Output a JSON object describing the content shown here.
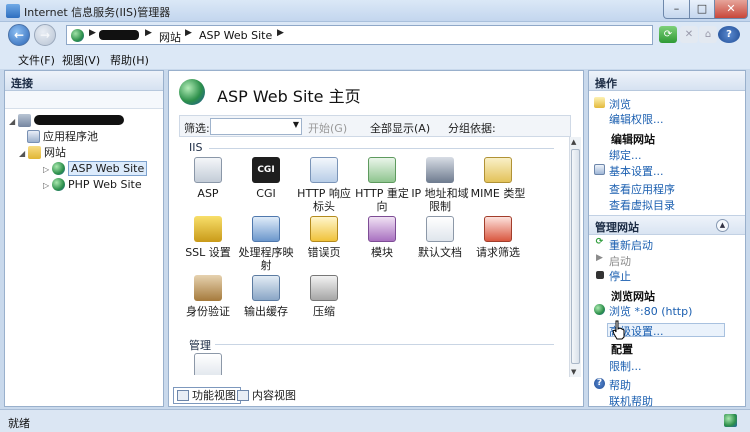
{
  "window": {
    "title": "Internet 信息服务(IIS)管理器"
  },
  "address": {
    "crumbs": [
      "网站",
      "ASP Web Site"
    ]
  },
  "menu": [
    "文件(F)",
    "视图(V)",
    "帮助(H)"
  ],
  "left_panel": {
    "header": "连接",
    "tree": {
      "app_pools": "应用程序池",
      "sites": "网站",
      "site1": "ASP Web Site",
      "site2": "PHP Web Site"
    }
  },
  "center": {
    "title": "ASP Web Site 主页",
    "filter": {
      "label": "筛选:",
      "start": "开始(G)",
      "show_all": "全部显示(A)",
      "group_by": "分组依据:"
    },
    "groups": {
      "iis": "IIS",
      "management": "管理"
    },
    "features": {
      "asp": "ASP",
      "cgi": "CGI",
      "cgi_glyph": "CGI",
      "http_headers": "HTTP 响应标头",
      "http_redirect": "HTTP 重定向",
      "ip_domain": "IP 地址和域限制",
      "mime": "MIME 类型",
      "ssl": "SSL 设置",
      "handler": "处理程序映射",
      "error_pages": "错误页",
      "modules": "模块",
      "default_doc": "默认文档",
      "request_filter": "请求筛选",
      "auth": "身份验证",
      "output_cache": "输出缓存",
      "compression": "压缩"
    },
    "view_tabs": {
      "features": "功能视图",
      "content": "内容视图"
    }
  },
  "right_panel": {
    "header": "操作",
    "browse": "浏览",
    "edit_perms": "编辑权限...",
    "edit_site": "编辑网站",
    "bindings": "绑定...",
    "basic_settings": "基本设置...",
    "view_apps": "查看应用程序",
    "view_vdirs": "查看虚拟目录",
    "manage_site": "管理网站",
    "restart": "重新启动",
    "start": "启动",
    "stop": "停止",
    "browse_site": "浏览网站",
    "browse_port": "浏览 *:80 (http)",
    "advanced": "高级设置...",
    "configure": "配置",
    "limits": "限制...",
    "help": "帮助",
    "online_help": "联机帮助"
  },
  "status": {
    "text": "就绪"
  },
  "icons": [
    "back-icon",
    "forward-icon",
    "globe-icon",
    "refresh-icon",
    "stop-icon",
    "home-icon",
    "help-icon",
    "cursor-hand-icon"
  ]
}
